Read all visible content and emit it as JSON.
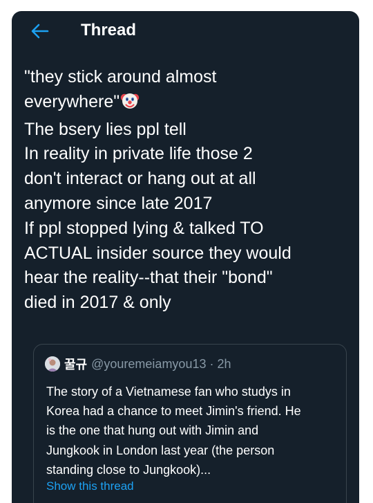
{
  "header": {
    "title": "Thread"
  },
  "tweet": {
    "lines": [
      "\"they stick around almost",
      "everywhere\"",
      "The bsery lies ppl tell",
      "In reality in private life those 2",
      "don't interact or hang out at all",
      "anymore since late 2017",
      "If ppl stopped lying & talked TO",
      "ACTUAL insider source they would",
      "hear the reality--that their \"bond\"",
      "died in 2017 & only"
    ],
    "emoji_icon": "clown-face-icon"
  },
  "quoted_tweet": {
    "display_name": "꿀규",
    "handle": "@youremeiamyou13",
    "separator": "·",
    "time": "2h",
    "lines": [
      "The story of a Vietnamese fan who studys in",
      "Korea had a chance to meet Jimin's friend. He",
      "is the one that hung out with Jimin and",
      "Jungkook in London last year (the person",
      "standing close to Jungkook)..."
    ],
    "show_thread_label": "Show this thread"
  },
  "colors": {
    "background": "#15202b",
    "text": "#ffffff",
    "accent": "#1da1f2",
    "muted": "#8899a6",
    "border": "#38444d"
  }
}
